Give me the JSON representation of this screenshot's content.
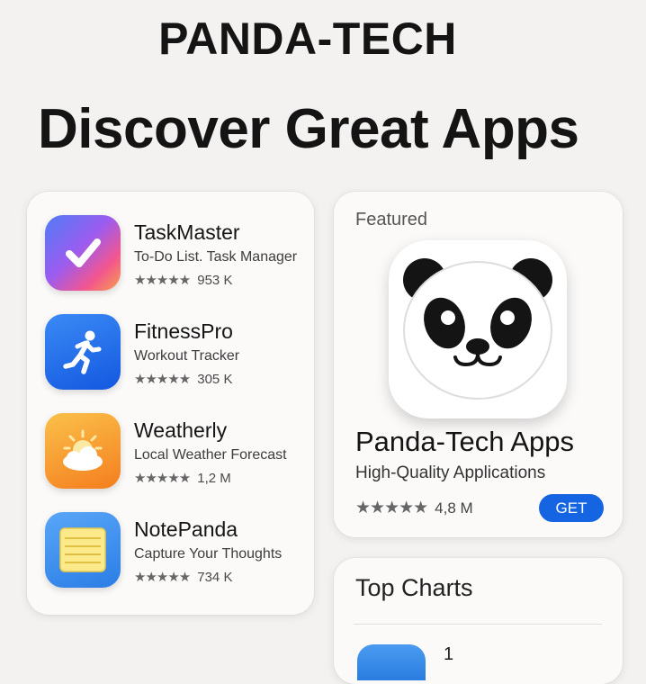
{
  "header": {
    "brand": "PANDA-TECH",
    "headline": "Discover Great Apps"
  },
  "app_list": [
    {
      "name": "TaskMaster",
      "subtitle": "To-Do List. Task Manager",
      "stars": "★★★★★",
      "count": "953 K",
      "icon": "checkmark-icon",
      "color": "#8a5cf5"
    },
    {
      "name": "FitnessPro",
      "subtitle": "Workout Tracker",
      "stars": "★★★★★",
      "count": "305 K",
      "icon": "running-person-icon",
      "color": "#1f6ff0"
    },
    {
      "name": "Weatherly",
      "subtitle": "Local Weather Forecast",
      "stars": "★★★★★",
      "count": "1,2 M",
      "icon": "sun-cloud-icon",
      "color": "#f59a2a"
    },
    {
      "name": "NotePanda",
      "subtitle": "Capture Your Thoughts",
      "stars": "★★★★★",
      "count": "734 K",
      "icon": "notepad-icon",
      "color": "#3a8ef2"
    }
  ],
  "featured": {
    "label": "Featured",
    "title": "Panda-Tech Apps",
    "subtitle": "High-Quality Applications",
    "stars": "★★★★★",
    "count": "4,8 M",
    "button": "GET",
    "icon": "panda-icon",
    "accent": "#1565e3"
  },
  "top_charts": {
    "title": "Top Charts",
    "first_item_label": "1"
  }
}
